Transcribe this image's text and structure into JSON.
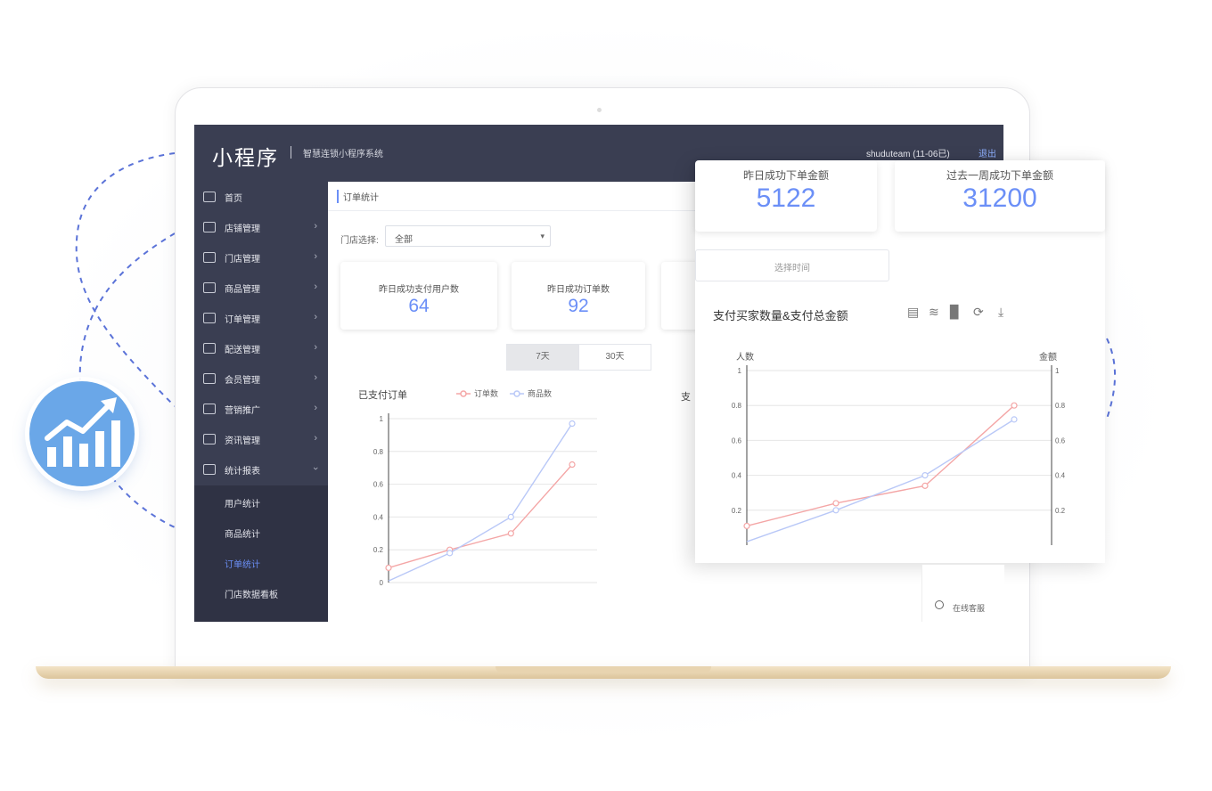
{
  "app": {
    "logo": "小程序",
    "subtitle": "智慧连锁小程序系统",
    "user": "shuduteam (11-06已)",
    "logout": "退出"
  },
  "sidebar": {
    "items": [
      {
        "label": "首页",
        "icon": "home-icon",
        "arrow": false
      },
      {
        "label": "店铺管理",
        "icon": "store-icon",
        "arrow": true
      },
      {
        "label": "门店管理",
        "icon": "shop-icon",
        "arrow": true
      },
      {
        "label": "商品管理",
        "icon": "goods-icon",
        "arrow": true
      },
      {
        "label": "订单管理",
        "icon": "order-icon",
        "arrow": true
      },
      {
        "label": "配送管理",
        "icon": "delivery-icon",
        "arrow": true
      },
      {
        "label": "会员管理",
        "icon": "member-icon",
        "arrow": true
      },
      {
        "label": "营销推广",
        "icon": "marketing-icon",
        "arrow": true
      },
      {
        "label": "资讯管理",
        "icon": "news-icon",
        "arrow": true
      },
      {
        "label": "统计报表",
        "icon": "stats-icon",
        "arrow": true,
        "expanded": true
      }
    ],
    "submenu": [
      {
        "label": "用户统计",
        "active": false
      },
      {
        "label": "商品统计",
        "active": false
      },
      {
        "label": "订单统计",
        "active": true
      },
      {
        "label": "门店数据看板",
        "active": false
      }
    ]
  },
  "main": {
    "breadcrumb": "订单统计",
    "filter_label": "门店选择:",
    "filter_value": "全部",
    "cards": [
      {
        "label": "昨日成功支付用户数",
        "value": "64"
      },
      {
        "label": "昨日成功订单数",
        "value": "92"
      }
    ],
    "tabs": [
      {
        "label": "7天",
        "active": true
      },
      {
        "label": "30天",
        "active": false
      }
    ],
    "chart_title": "已支付订单",
    "legend": [
      "订单数",
      "商品数"
    ],
    "partial_chart_title": "支"
  },
  "overlay": {
    "cards": [
      {
        "label": "昨日成功下单金额",
        "value": "5122"
      },
      {
        "label": "过去一周成功下单金额",
        "value": "31200"
      }
    ],
    "date_placeholder": "选择时间",
    "chart_title": "支付买家数量&支付总金额",
    "left_axis_name": "人数",
    "right_axis_name": "金额",
    "tools": [
      "data-view-icon",
      "line-chart-icon",
      "bar-chart-icon",
      "restore-icon",
      "download-icon"
    ]
  },
  "support": {
    "label": "在线客服"
  },
  "colors": {
    "accent": "#6b8ff7",
    "sidebar": "#3a3e52",
    "series_a": "#f4a6a6",
    "series_b": "#b9c8f7"
  },
  "chart_data": [
    {
      "type": "line",
      "title": "已支付订单",
      "ylim": [
        0,
        1
      ],
      "yticks": [
        "1",
        "0.8",
        "0.6",
        "0.4",
        "0.2",
        "0"
      ],
      "x": [
        0,
        1,
        2,
        3
      ],
      "series": [
        {
          "name": "订单数",
          "color": "#f4a6a6",
          "values": [
            0.09,
            0.2,
            0.3,
            0.72
          ]
        },
        {
          "name": "商品数",
          "color": "#b9c8f7",
          "values": [
            0.01,
            0.18,
            0.4,
            0.97
          ]
        }
      ]
    },
    {
      "type": "line",
      "title": "支付买家数量&支付总金额",
      "ylabel_left": "人数",
      "ylabel_right": "金额",
      "ylim": [
        0,
        1
      ],
      "yticks": [
        "1",
        "0.8",
        "0.6",
        "0.4",
        "0.2"
      ],
      "x": [
        0,
        1,
        2,
        3
      ],
      "series": [
        {
          "color": "#f4a6a6",
          "values": [
            0.11,
            0.24,
            0.34,
            0.8
          ]
        },
        {
          "color": "#b9c8f7",
          "values": [
            0.02,
            0.2,
            0.4,
            0.72
          ]
        }
      ]
    }
  ]
}
